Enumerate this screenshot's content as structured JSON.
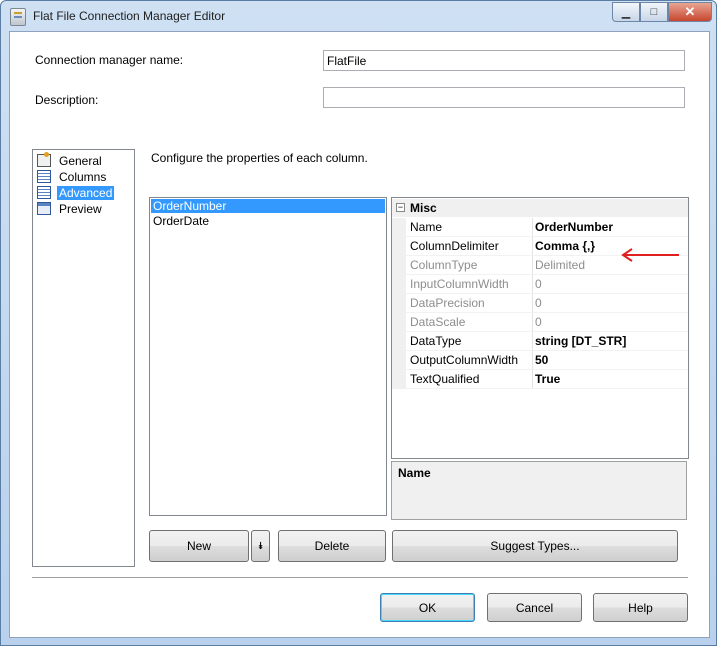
{
  "window": {
    "title": "Flat File Connection Manager Editor",
    "caption_buttons": {
      "minimize": "▁",
      "maximize": "□",
      "close": "✕"
    }
  },
  "form": {
    "connection_name_label": "Connection manager name:",
    "connection_name_value": "FlatFile",
    "description_label": "Description:",
    "description_value": ""
  },
  "nav": {
    "items": [
      {
        "label": "General",
        "icon": "general-icon"
      },
      {
        "label": "Columns",
        "icon": "columns-icon"
      },
      {
        "label": "Advanced",
        "icon": "advanced-icon",
        "selected": true
      },
      {
        "label": "Preview",
        "icon": "preview-icon"
      }
    ]
  },
  "advanced": {
    "instructions": "Configure the properties of each column.",
    "columns": [
      {
        "label": "OrderNumber",
        "selected": true
      },
      {
        "label": "OrderDate"
      }
    ],
    "properties": {
      "category": "Misc",
      "rows": [
        {
          "name": "Name",
          "value": "OrderNumber",
          "state": "bold"
        },
        {
          "name": "ColumnDelimiter",
          "value": "Comma {,}",
          "state": "bold"
        },
        {
          "name": "ColumnType",
          "value": "Delimited",
          "state": "disabled"
        },
        {
          "name": "InputColumnWidth",
          "value": "0",
          "state": "disabled"
        },
        {
          "name": "DataPrecision",
          "value": "0",
          "state": "disabled"
        },
        {
          "name": "DataScale",
          "value": "0",
          "state": "disabled"
        },
        {
          "name": "DataType",
          "value": "string [DT_STR]",
          "state": "bold"
        },
        {
          "name": "OutputColumnWidth",
          "value": "50",
          "state": "bold"
        },
        {
          "name": "TextQualified",
          "value": "True",
          "state": "bold"
        }
      ],
      "description_title": "Name"
    },
    "buttons": {
      "new": "New",
      "new_dropdown": "⯯",
      "delete": "Delete",
      "suggest": "Suggest Types..."
    }
  },
  "footer": {
    "ok": "OK",
    "cancel": "Cancel",
    "help": "Help"
  },
  "colors": {
    "selection": "#3399ff",
    "annotation_arrow": "#e02020"
  }
}
